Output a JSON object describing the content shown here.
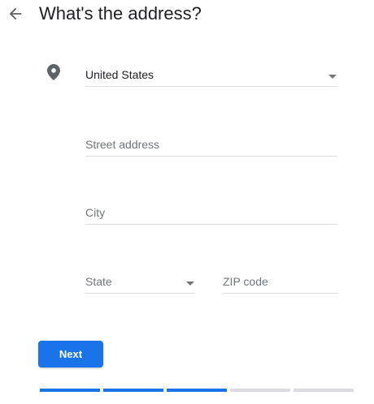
{
  "header": {
    "title": "What's the address?",
    "back_icon": "arrow-back-icon"
  },
  "form": {
    "location_icon": "map-pin-icon",
    "country": {
      "value": "United States"
    },
    "street": {
      "placeholder": "Street address"
    },
    "city": {
      "placeholder": "City"
    },
    "state": {
      "placeholder": "State"
    },
    "zip": {
      "placeholder": "ZIP code"
    }
  },
  "actions": {
    "next_label": "Next"
  },
  "progress": {
    "total_steps": 5,
    "completed_steps": 3,
    "active_color": "#1a73e8",
    "inactive_color": "#dadce0"
  },
  "colors": {
    "accent": "#1a73e8",
    "title_text": "#202124",
    "placeholder_text": "#70757a",
    "underline": "#dadce0",
    "icon": "#5f6368"
  }
}
